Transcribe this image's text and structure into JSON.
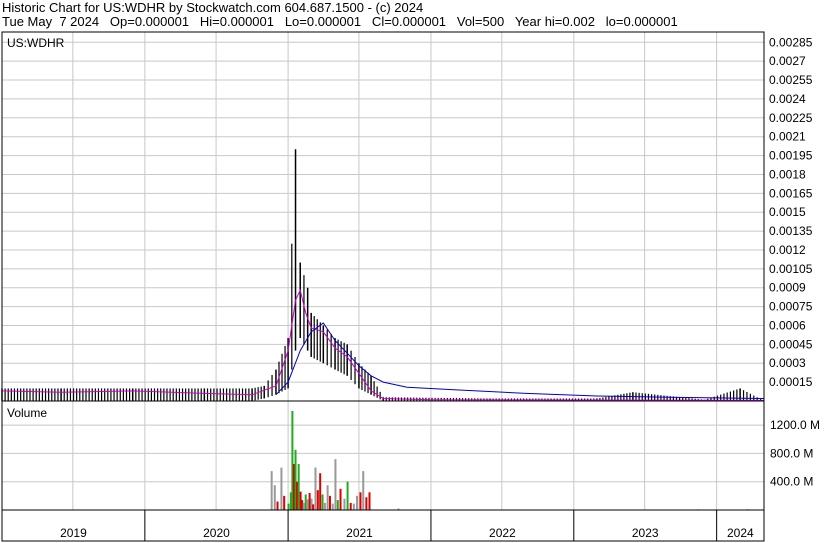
{
  "header": {
    "title_line": "Historic Chart for US:WDHR by Stockwatch.com 604.687.1500 - (c) 2024",
    "quote_line": "Tue May  7 2024   Op=0.000001   Hi=0.000001   Lo=0.000001   Cl=0.000001   Vol=500   Year hi=0.002   lo=0.000001"
  },
  "price_panel": {
    "symbol_label": "US:WDHR"
  },
  "volume_panel": {
    "label": "Volume"
  },
  "colors": {
    "price_bars": "#000000",
    "ma_short": "#cc00cc",
    "ma_long": "#0000cc",
    "volume_up": "#22aa22",
    "volume_down": "#dd0000",
    "volume_neutral": "#999999",
    "grid": "#c8c8c8"
  },
  "chart_data": [
    {
      "type": "line",
      "title": "US:WDHR",
      "x_axis_labels": [
        "2019",
        "2020",
        "2021",
        "2022",
        "2023",
        "2024"
      ],
      "y_ticks": [
        "0.00015",
        "0.0003",
        "0.00045",
        "0.0006",
        "0.00075",
        "0.0009",
        "0.00105",
        "0.0012",
        "0.00135",
        "0.0015",
        "0.00165",
        "0.0018",
        "0.00195",
        "0.0021",
        "0.00225",
        "0.0024",
        "0.00255",
        "0.0027",
        "0.00285"
      ],
      "ylim": [
        0,
        0.0029
      ],
      "x_range": [
        "2019-01",
        "2024-05"
      ],
      "grid": true,
      "series": [
        {
          "kind": "price-range",
          "points": [
            {
              "x": "2019-01",
              "lo": 1e-06,
              "hi": 0.0001
            },
            {
              "x": "2019-06",
              "lo": 1e-06,
              "hi": 0.0001
            },
            {
              "x": "2019-12",
              "lo": 1e-06,
              "hi": 0.0001
            },
            {
              "x": "2020-06",
              "lo": 1e-06,
              "hi": 0.0001
            },
            {
              "x": "2020-10",
              "lo": 1e-06,
              "hi": 0.0001
            },
            {
              "x": "2020-11",
              "lo": 2e-05,
              "hi": 0.00012
            },
            {
              "x": "2020-12",
              "lo": 5e-05,
              "hi": 0.00025
            },
            {
              "x": "2021-01",
              "lo": 0.0001,
              "hi": 0.0005
            },
            {
              "x": "2021-01-20",
              "lo": 0.0004,
              "hi": 0.002
            },
            {
              "x": "2021-02",
              "lo": 0.0005,
              "hi": 0.0011
            },
            {
              "x": "2021-02-20",
              "lo": 0.0004,
              "hi": 0.0009
            },
            {
              "x": "2021-03",
              "lo": 0.00035,
              "hi": 0.0007
            },
            {
              "x": "2021-04",
              "lo": 0.0003,
              "hi": 0.0006
            },
            {
              "x": "2021-05",
              "lo": 0.00025,
              "hi": 0.0005
            },
            {
              "x": "2021-06",
              "lo": 0.0002,
              "hi": 0.00045
            },
            {
              "x": "2021-07",
              "lo": 0.0001,
              "hi": 0.0003
            },
            {
              "x": "2021-08",
              "lo": 5e-05,
              "hi": 0.0002
            },
            {
              "x": "2021-09",
              "lo": 1e-06,
              "hi": 3e-05
            },
            {
              "x": "2022-06",
              "lo": 1e-06,
              "hi": 2e-05
            },
            {
              "x": "2023-03",
              "lo": 1e-06,
              "hi": 2e-05
            },
            {
              "x": "2023-06",
              "lo": 1e-06,
              "hi": 7e-05
            },
            {
              "x": "2023-12",
              "lo": 1e-06,
              "hi": 1e-05
            },
            {
              "x": "2024-03",
              "lo": 1e-06,
              "hi": 0.0001
            },
            {
              "x": "2024-05",
              "lo": 1e-06,
              "hi": 1e-06
            }
          ]
        },
        {
          "kind": "moving-average-short",
          "points": [
            {
              "x": "2019-01",
              "y": 8e-05
            },
            {
              "x": "2019-06",
              "y": 7e-05
            },
            {
              "x": "2019-12",
              "y": 8e-05
            },
            {
              "x": "2020-06",
              "y": 6e-05
            },
            {
              "x": "2020-10",
              "y": 5e-05
            },
            {
              "x": "2020-12",
              "y": 0.00012
            },
            {
              "x": "2021-01",
              "y": 0.0004
            },
            {
              "x": "2021-01-20",
              "y": 0.0008
            },
            {
              "x": "2021-02",
              "y": 0.00088
            },
            {
              "x": "2021-02-15",
              "y": 0.0007
            },
            {
              "x": "2021-03",
              "y": 0.00058
            },
            {
              "x": "2021-04",
              "y": 0.00055
            },
            {
              "x": "2021-05",
              "y": 0.00042
            },
            {
              "x": "2021-06",
              "y": 0.00035
            },
            {
              "x": "2021-07",
              "y": 0.00022
            },
            {
              "x": "2021-08",
              "y": 8e-05
            },
            {
              "x": "2021-09",
              "y": 2e-05
            },
            {
              "x": "2022-01",
              "y": 1e-05
            },
            {
              "x": "2024-05",
              "y": 5e-06
            }
          ]
        },
        {
          "kind": "moving-average-long",
          "points": [
            {
              "x": "2020-12",
              "y": 5e-05
            },
            {
              "x": "2021-01",
              "y": 0.00015
            },
            {
              "x": "2021-02",
              "y": 0.0004
            },
            {
              "x": "2021-03",
              "y": 0.00055
            },
            {
              "x": "2021-04",
              "y": 0.00062
            },
            {
              "x": "2021-05",
              "y": 0.00048
            },
            {
              "x": "2021-06",
              "y": 0.00038
            },
            {
              "x": "2021-07",
              "y": 0.00028
            },
            {
              "x": "2021-08",
              "y": 0.0002
            },
            {
              "x": "2021-09",
              "y": 0.00015
            },
            {
              "x": "2021-11",
              "y": 0.00011
            },
            {
              "x": "2022-03",
              "y": 9e-05
            },
            {
              "x": "2022-09",
              "y": 6e-05
            },
            {
              "x": "2023-03",
              "y": 4e-05
            },
            {
              "x": "2023-09",
              "y": 3e-05
            },
            {
              "x": "2024-05",
              "y": 2e-05
            }
          ]
        }
      ]
    },
    {
      "type": "bar",
      "title": "Volume",
      "y_ticks": [
        "400.0 M",
        "800.0 M",
        "1200.0 M"
      ],
      "ylim": [
        0,
        1400
      ],
      "unit": "M",
      "bars": [
        {
          "x": "2020-11-20",
          "v": 550,
          "c": "neutral"
        },
        {
          "x": "2020-11-28",
          "v": 350,
          "c": "neutral"
        },
        {
          "x": "2020-12-05",
          "v": 120,
          "c": "down"
        },
        {
          "x": "2020-12-15",
          "v": 600,
          "c": "neutral"
        },
        {
          "x": "2020-12-22",
          "v": 200,
          "c": "down"
        },
        {
          "x": "2021-01-02",
          "v": 90,
          "c": "up"
        },
        {
          "x": "2021-01-08",
          "v": 250,
          "c": "up"
        },
        {
          "x": "2021-01-12",
          "v": 1400,
          "c": "up"
        },
        {
          "x": "2021-01-16",
          "v": 650,
          "c": "down"
        },
        {
          "x": "2021-01-20",
          "v": 850,
          "c": "up"
        },
        {
          "x": "2021-01-24",
          "v": 400,
          "c": "down"
        },
        {
          "x": "2021-01-28",
          "v": 650,
          "c": "up"
        },
        {
          "x": "2021-02-02",
          "v": 260,
          "c": "down"
        },
        {
          "x": "2021-02-06",
          "v": 140,
          "c": "down"
        },
        {
          "x": "2021-02-10",
          "v": 100,
          "c": "neutral"
        },
        {
          "x": "2021-02-15",
          "v": 220,
          "c": "up"
        },
        {
          "x": "2021-02-20",
          "v": 150,
          "c": "neutral"
        },
        {
          "x": "2021-02-25",
          "v": 240,
          "c": "down"
        },
        {
          "x": "2021-03-02",
          "v": 160,
          "c": "neutral"
        },
        {
          "x": "2021-03-06",
          "v": 80,
          "c": "down"
        },
        {
          "x": "2021-03-12",
          "v": 600,
          "c": "neutral"
        },
        {
          "x": "2021-03-18",
          "v": 280,
          "c": "down"
        },
        {
          "x": "2021-03-24",
          "v": 520,
          "c": "down"
        },
        {
          "x": "2021-03-30",
          "v": 220,
          "c": "up"
        },
        {
          "x": "2021-04-05",
          "v": 100,
          "c": "neutral"
        },
        {
          "x": "2021-04-12",
          "v": 350,
          "c": "neutral"
        },
        {
          "x": "2021-04-18",
          "v": 200,
          "c": "down"
        },
        {
          "x": "2021-04-25",
          "v": 90,
          "c": "neutral"
        },
        {
          "x": "2021-05-02",
          "v": 720,
          "c": "neutral"
        },
        {
          "x": "2021-05-08",
          "v": 140,
          "c": "up"
        },
        {
          "x": "2021-05-15",
          "v": 300,
          "c": "down"
        },
        {
          "x": "2021-05-25",
          "v": 160,
          "c": "neutral"
        },
        {
          "x": "2021-06-02",
          "v": 400,
          "c": "up"
        },
        {
          "x": "2021-06-10",
          "v": 100,
          "c": "down"
        },
        {
          "x": "2021-06-18",
          "v": 90,
          "c": "neutral"
        },
        {
          "x": "2021-06-26",
          "v": 200,
          "c": "neutral"
        },
        {
          "x": "2021-07-05",
          "v": 250,
          "c": "down"
        },
        {
          "x": "2021-07-12",
          "v": 550,
          "c": "neutral"
        },
        {
          "x": "2021-07-20",
          "v": 180,
          "c": "down"
        },
        {
          "x": "2021-07-28",
          "v": 250,
          "c": "down"
        },
        {
          "x": "2021-10-10",
          "v": 20,
          "c": "neutral"
        },
        {
          "x": "2023-11-15",
          "v": 10,
          "c": "neutral"
        },
        {
          "x": "2024-03-20",
          "v": 12,
          "c": "neutral"
        }
      ]
    }
  ]
}
